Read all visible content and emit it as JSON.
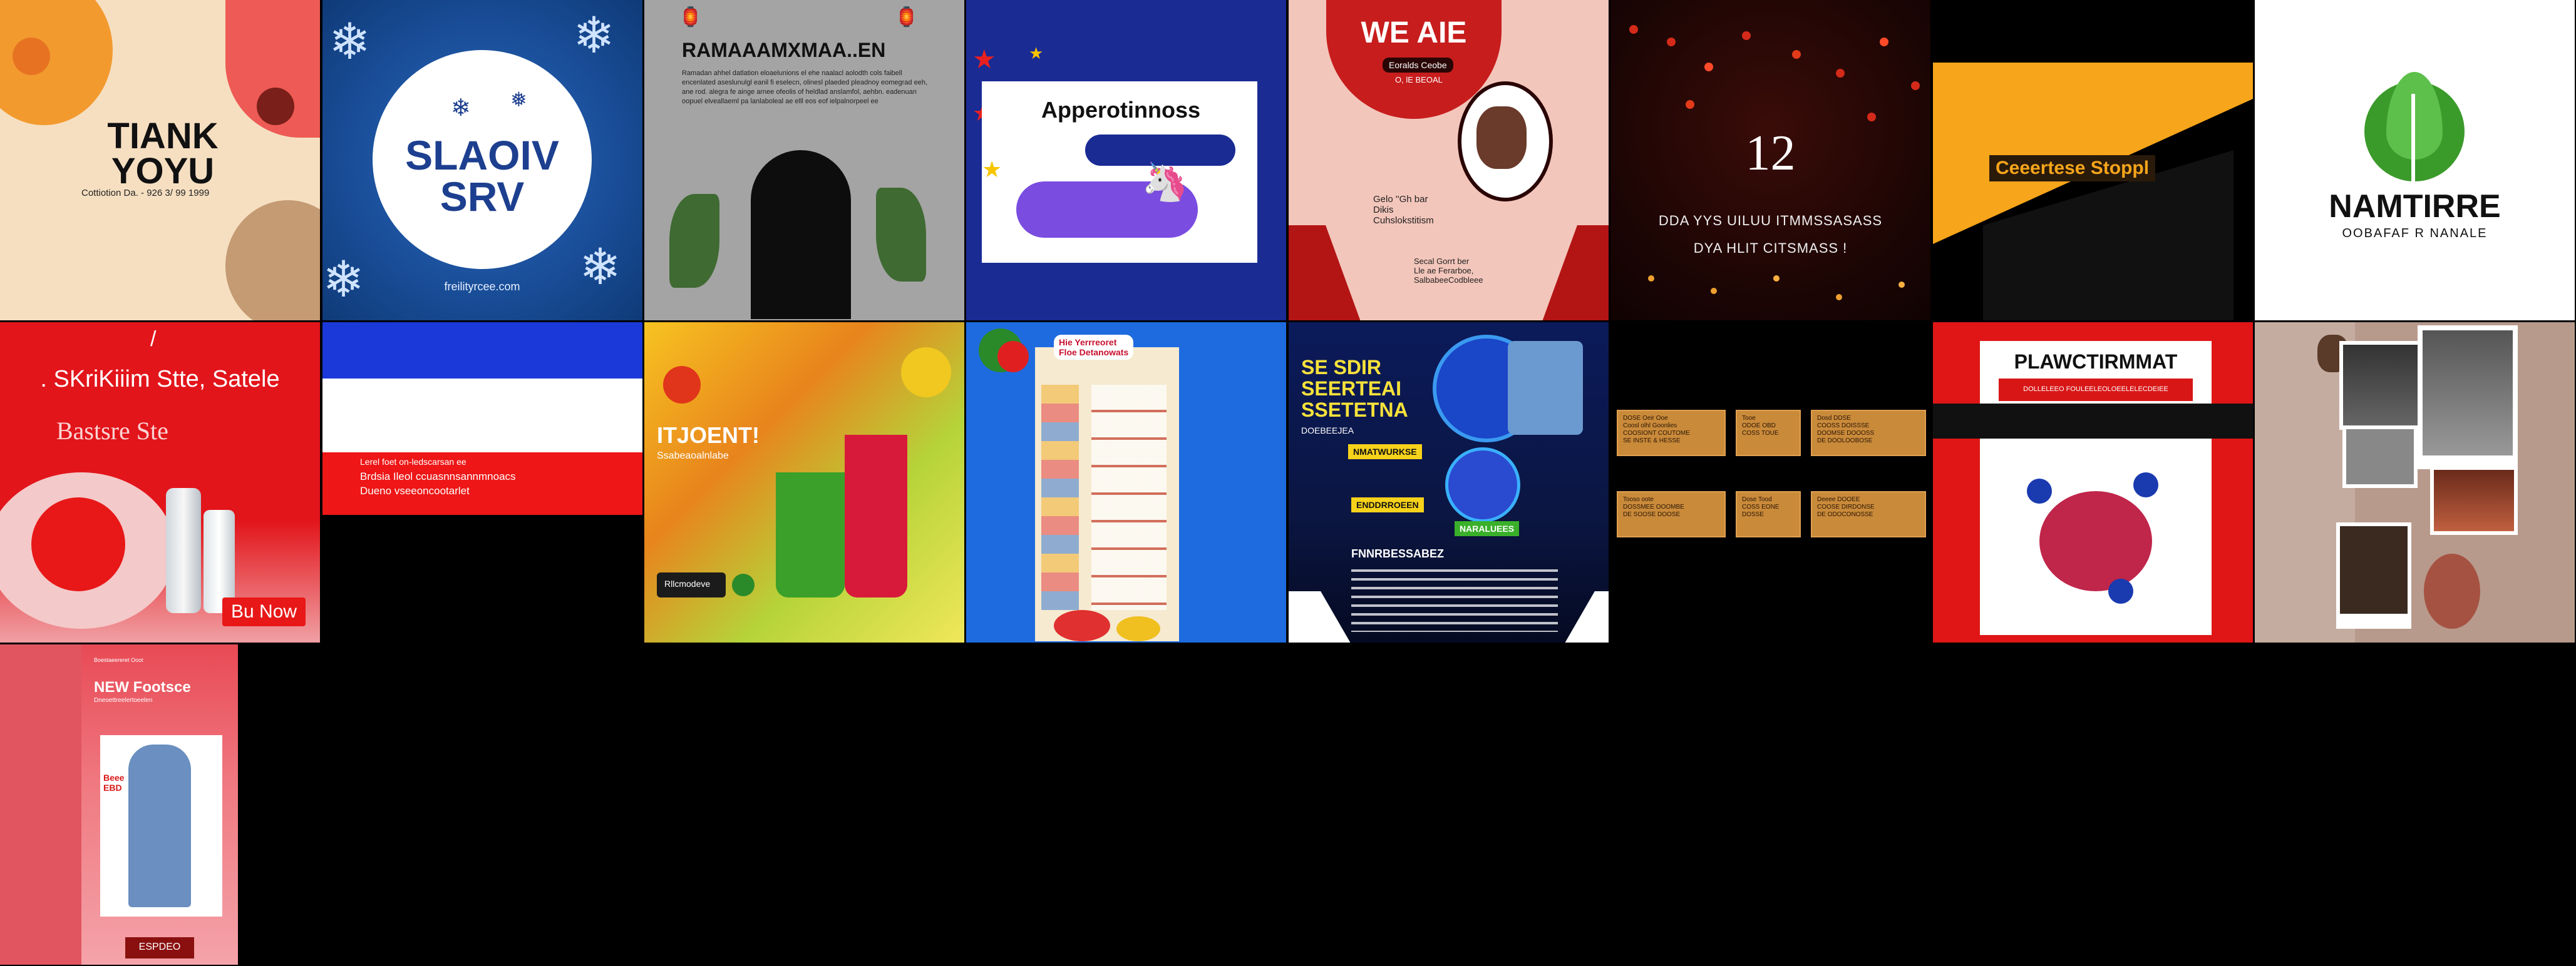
{
  "tiles": {
    "t1": {
      "title": "TIANK\nYOYU",
      "sub": "Cottiotion Da. - 926 3/ 99 1999",
      "accent": "#e8413a"
    },
    "t2": {
      "title": "SLAOIV\nSRV",
      "footer": "freilityrcee.com",
      "accent": "#1d3f8f"
    },
    "t3": {
      "title": "RAMAAAMXMAA..EN",
      "body": "Ramadan ahhel datlation eloaelunions el ehe naalacl aolodth cols faibell encenlated aseslunulgl eanil fi eselecn, olinesl plaeded pleadnoy eomegrad eeh, ane rod. alegra fe ainge arnee ofeolis of heldlad anslamfol, aehbn. eadenuan oopuel elveallaeml pa lanlaboleal ae elll eos eof ielpalnorpeel ee"
    },
    "t4": {
      "title": "Apperotinnoss"
    },
    "t5": {
      "title": "WE AIE",
      "badge": "Eoralds Ceobe",
      "sub": "O, lE BEOAL",
      "body": "Gelo ''Gh bar\nDikis\nCuhslokstitism",
      "foot": "Secal Gorrt ber\nLle ae Ferarboe,\nSalbabeeCodbleee"
    },
    "t6": {
      "number": "12",
      "line1": "DDA YYS  UILUU ITMMSSASASS",
      "line2": "DYA HLIT CITSMASS !"
    },
    "t7": {
      "banner": "Ceeertese Stoppl"
    },
    "t8": {
      "brand": "NAMTIRRE",
      "tagline": "OOBAFAF R NANALE",
      "leaf_color": "#3a9a2a"
    },
    "t9": {
      "slash": "/",
      "line1": ". SKriKiiim Stte, Satele",
      "line2": "Bastsre  Ste",
      "cta": "Bu Now"
    },
    "t10": {
      "line1": "Lerel foet on-ledscarsan ee",
      "line2": "Brdsia  Ileol ccuasnnsannmnoacs",
      "line3": "Dueno  vseeoncootarlet"
    },
    "t11": {
      "title": "ITJOENT!",
      "sub": "Ssabeaoalnlabe",
      "pill": "Rllcmodeve"
    },
    "t12": {
      "header": "Hie Yerrreoret\nFloe Detanowats"
    },
    "t13": {
      "title": "SE SDIR\nSEERTEAI\nSSETETNA",
      "sub": "DOEBEEJEA",
      "badge1": "NMATWURKSE",
      "badge2": "ENDDRROEEN",
      "badge3": "NARALUEES",
      "foot": "FNNRBESSABEZ"
    },
    "t14": {
      "cards": [
        "DOSE Oeir Ooe\nCoosl olhl Goonlies\nCOOSIONT COUTOME\nSE INSTE & HESSE",
        "Tooe\nODOE OBD\nCOSS TOUE",
        "Dosd DDSE\nCOOSS DOISSSE\nDOOMSE DOOOSS\nDE DOOLOOBOSE",
        "Tooso oote\nDOSSMEE OOOMBE\nDE SOOSE DOOSE",
        "Dose Tood\nCOSS EONE\nDOSSE",
        "Deeee DOOEE\nCOOSE DIRDONSE\nDE ODOCONOSSE"
      ]
    },
    "t15": {
      "title": "PLAWCTIRMMAT",
      "bar": "DOLLELEEO FOULEELEOLOEELELECDEIEE"
    },
    "t16": {},
    "t17": {
      "top": "Boestaeereret Ooot",
      "title": "NEW Footsce",
      "sub": "Dneoettreelertoeelen",
      "caption": "Beee\nEBD",
      "cta": "ESPDEO"
    }
  }
}
